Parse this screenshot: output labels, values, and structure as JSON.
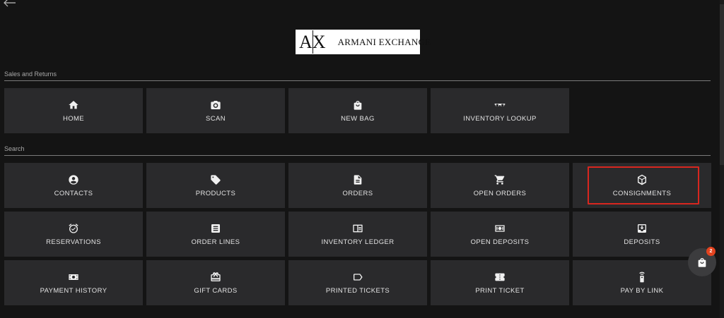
{
  "logo": {
    "mark_left": "A",
    "mark_right": "X",
    "text": "ARMANI EXCHANGE"
  },
  "sections": [
    {
      "label": "Sales and Returns",
      "tiles": [
        {
          "icon": "home-icon",
          "label": "HOME"
        },
        {
          "icon": "camera-icon",
          "label": "SCAN"
        },
        {
          "icon": "shopping-bag-icon",
          "label": "NEW BAG"
        },
        {
          "icon": "glasses-icon",
          "label": "INVENTORY LOOKUP"
        }
      ]
    },
    {
      "label": "Search",
      "tiles": [
        {
          "icon": "person-icon",
          "label": "CONTACTS"
        },
        {
          "icon": "tag-icon",
          "label": "PRODUCTS"
        },
        {
          "icon": "document-icon",
          "label": "ORDERS"
        },
        {
          "icon": "cart-icon",
          "label": "OPEN ORDERS"
        },
        {
          "icon": "box-icon",
          "label": "CONSIGNMENTS"
        },
        {
          "icon": "alarm-clock-icon",
          "label": "RESERVATIONS"
        },
        {
          "icon": "list-icon",
          "label": "ORDER LINES"
        },
        {
          "icon": "ledger-icon",
          "label": "INVENTORY LEDGER"
        },
        {
          "icon": "cash-icon",
          "label": "OPEN DEPOSITS"
        },
        {
          "icon": "deposit-tray-icon",
          "label": "DEPOSITS"
        },
        {
          "icon": "money-icon",
          "label": "PAYMENT HISTORY"
        },
        {
          "icon": "gift-card-icon",
          "label": "GIFT CARDS"
        },
        {
          "icon": "label-tag-icon",
          "label": "PRINTED TICKETS"
        },
        {
          "icon": "ticket-icon",
          "label": "PRINT TICKET"
        },
        {
          "icon": "remote-link-icon",
          "label": "PAY BY LINK"
        }
      ]
    }
  ],
  "cart": {
    "count": "2"
  },
  "colors": {
    "background": "#141414",
    "tile": "#2a2a2c",
    "highlight": "#d8261f",
    "badge": "#e3431f"
  }
}
